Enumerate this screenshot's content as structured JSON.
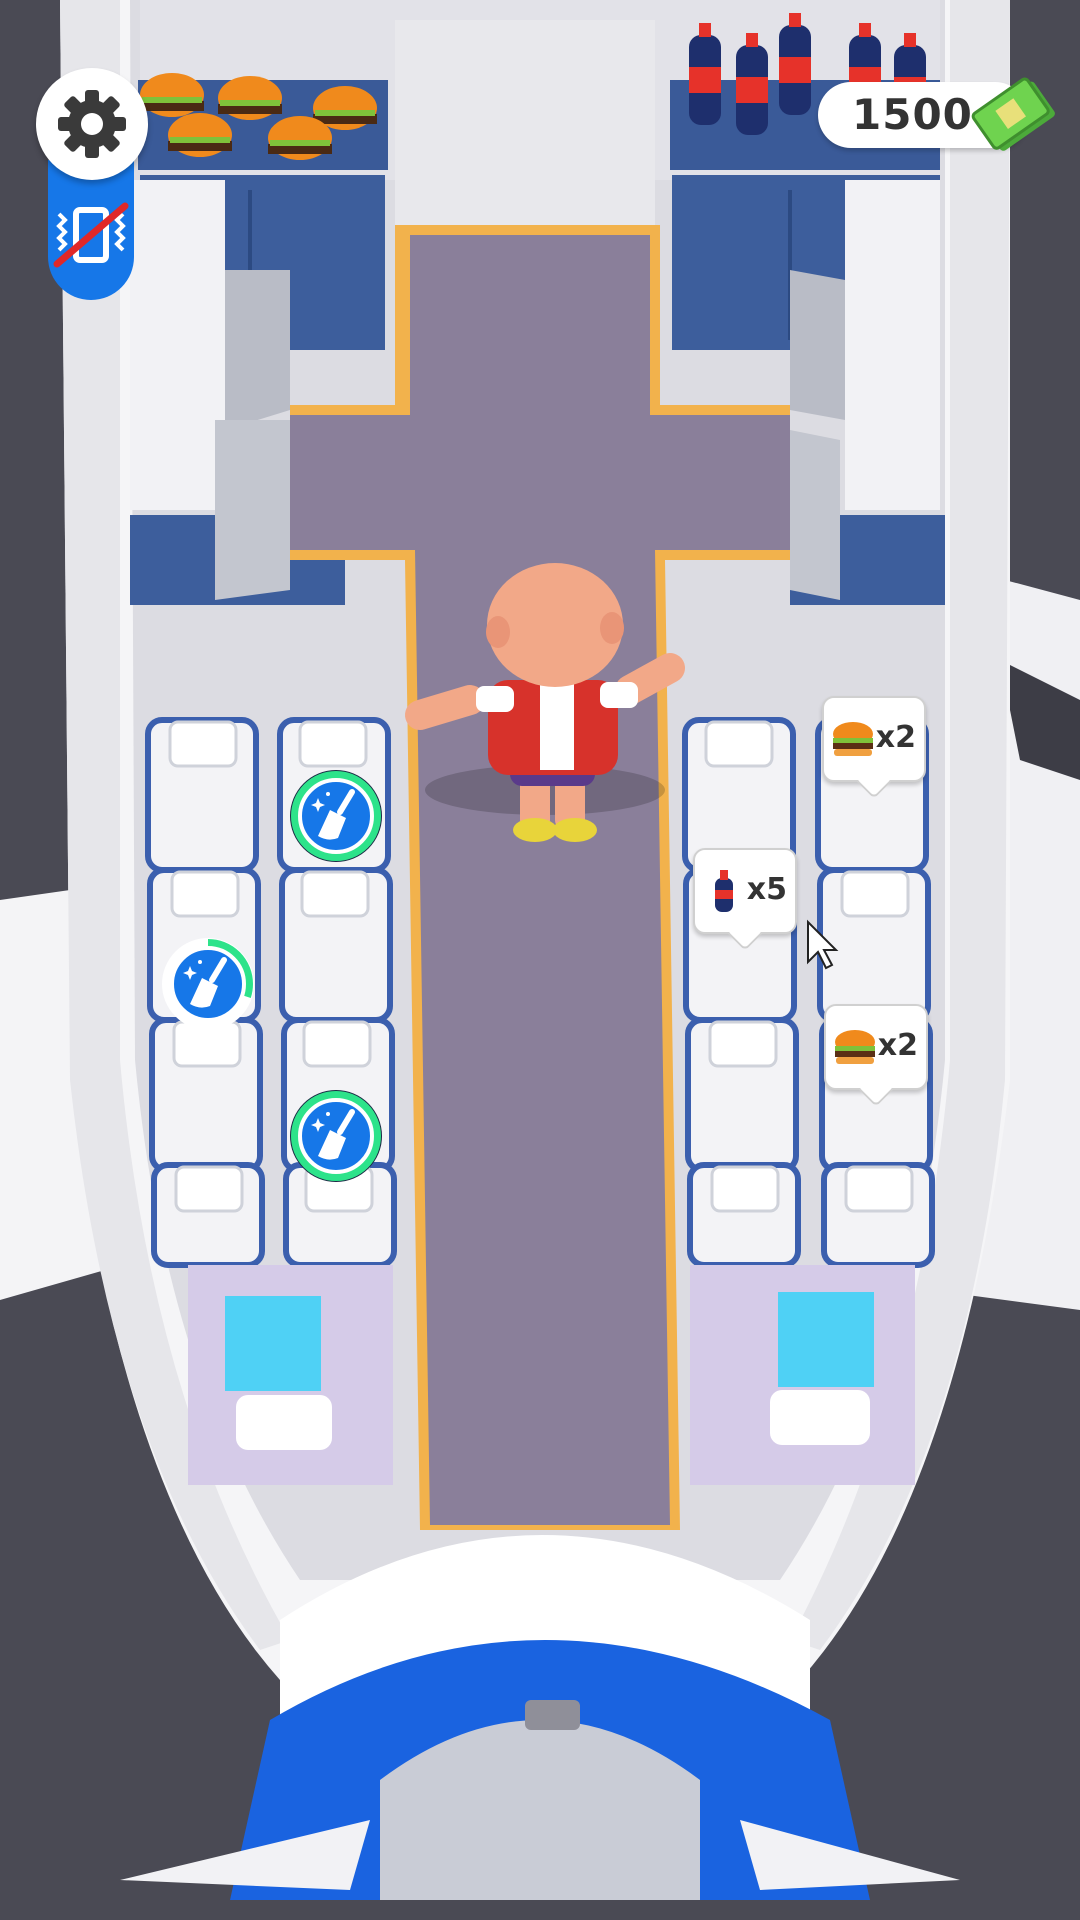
{
  "hud": {
    "settings_icon": "gear-icon",
    "vibration_icon": "vibration-off-icon",
    "money": "1500",
    "money_icon": "cash-icon"
  },
  "orders": [
    {
      "item": "burger",
      "icon": "burger-icon",
      "qty": "x2"
    },
    {
      "item": "soda",
      "icon": "soda-bottle-icon",
      "qty": "x5"
    },
    {
      "item": "burger",
      "icon": "burger-icon",
      "qty": "x2"
    }
  ],
  "clean_tasks": [
    {
      "icon": "broom-icon",
      "progress": 1.0
    },
    {
      "icon": "broom-icon",
      "progress": 0.3
    },
    {
      "icon": "broom-icon",
      "progress": 1.0
    }
  ],
  "colors": {
    "accent_blue": "#1677e8",
    "progress_green": "#2de38a",
    "aisle": "#8a7f9a",
    "aisle_trim": "#f2b24c",
    "shirt_red": "#d7322b"
  }
}
